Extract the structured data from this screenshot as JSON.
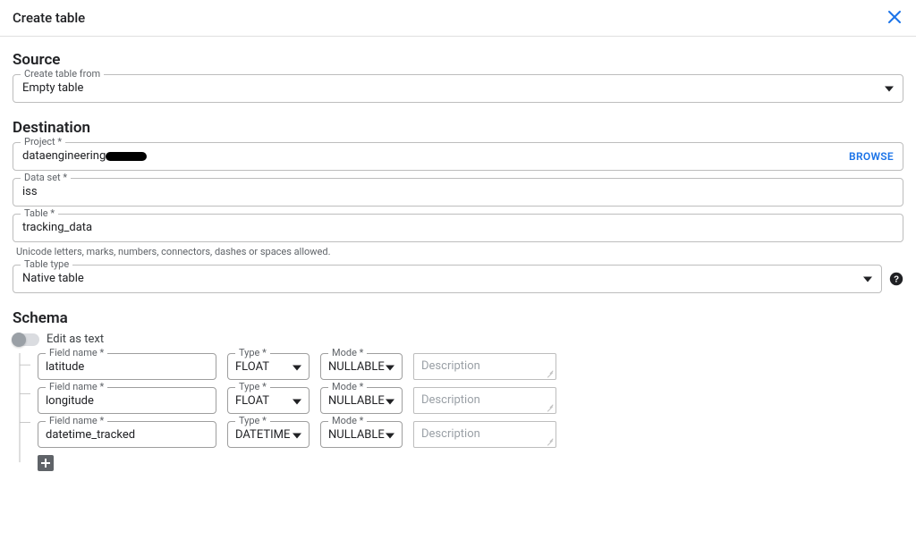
{
  "header": {
    "title": "Create table"
  },
  "source": {
    "heading": "Source",
    "create_from_label": "Create table from",
    "create_from_value": "Empty table"
  },
  "destination": {
    "heading": "Destination",
    "project_label": "Project *",
    "project_value_prefix": "dataengineering",
    "browse": "BROWSE",
    "dataset_label": "Data set *",
    "dataset_value": "iss",
    "table_label": "Table *",
    "table_value": "tracking_data",
    "table_helper": "Unicode letters, marks, numbers, connectors, dashes or spaces allowed.",
    "tabletype_label": "Table type",
    "tabletype_value": "Native table"
  },
  "schema": {
    "heading": "Schema",
    "edit_as_text": "Edit as text",
    "field_name_label": "Field name *",
    "type_label": "Type *",
    "mode_label": "Mode *",
    "description_placeholder": "Description",
    "rows": [
      {
        "name": "latitude",
        "type": "FLOAT",
        "mode": "NULLABLE",
        "description": ""
      },
      {
        "name": "longitude",
        "type": "FLOAT",
        "mode": "NULLABLE",
        "description": ""
      },
      {
        "name": "datetime_tracked",
        "type": "DATETIME",
        "mode": "NULLABLE",
        "description": ""
      }
    ]
  }
}
